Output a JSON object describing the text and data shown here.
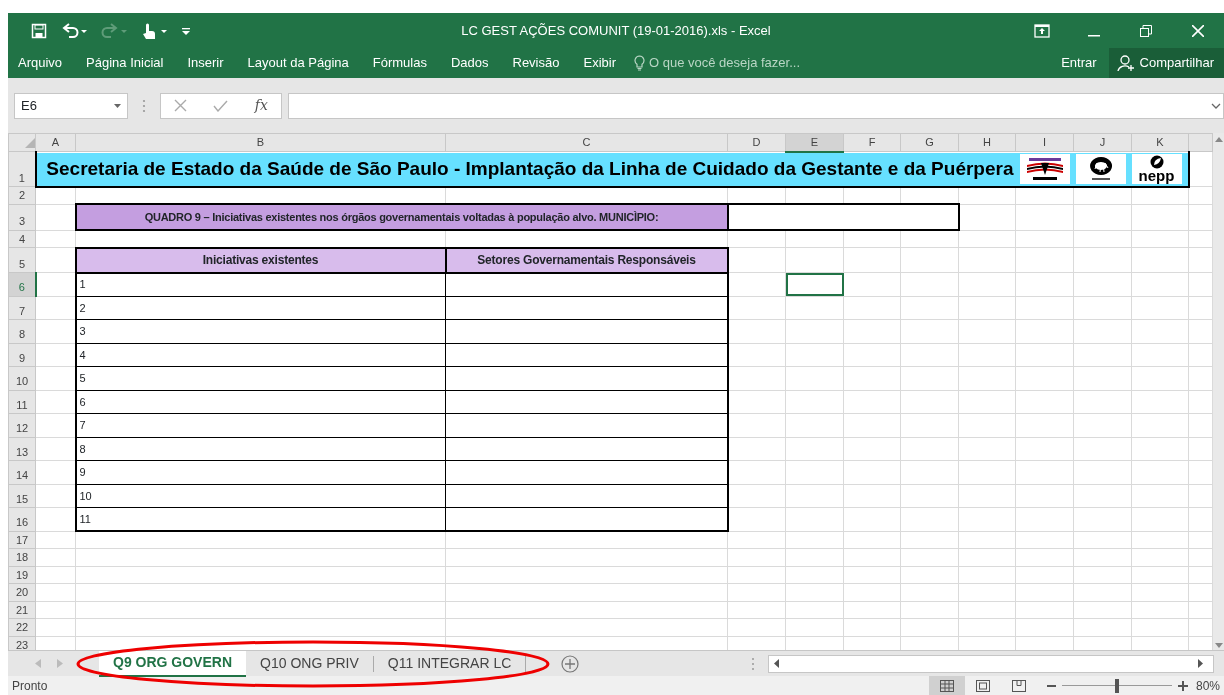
{
  "window": {
    "title": "LC GEST AÇÕES COMUNIT (19-01-2016).xls - Excel"
  },
  "quick_access": [
    {
      "kind": "save",
      "disabled": false
    },
    {
      "kind": "undo",
      "disabled": false
    },
    {
      "kind": "redo",
      "disabled": true
    },
    {
      "kind": "touch",
      "disabled": false
    },
    {
      "kind": "customize",
      "disabled": false
    }
  ],
  "ribbon_tabs": [
    {
      "label": "Arquivo",
      "selected": false
    },
    {
      "label": "Página Inicial",
      "selected": false
    },
    {
      "label": "Inserir",
      "selected": false
    },
    {
      "label": "Layout da Página",
      "selected": false
    },
    {
      "label": "Fórmulas",
      "selected": false
    },
    {
      "label": "Dados",
      "selected": false
    },
    {
      "label": "Revisão",
      "selected": false
    },
    {
      "label": "Exibir",
      "selected": false
    }
  ],
  "tell_me": {
    "placeholder": "O que você deseja fazer..."
  },
  "account": {
    "sign_in": "Entrar",
    "share": "Compartilhar"
  },
  "formula_bar": {
    "name_box": "E6",
    "function_label": "fx"
  },
  "sheet": {
    "columns": [
      {
        "label": "A",
        "selected": false
      },
      {
        "label": "B",
        "selected": false
      },
      {
        "label": "C",
        "selected": false
      },
      {
        "label": "D",
        "selected": false
      },
      {
        "label": "E",
        "selected": true
      },
      {
        "label": "F",
        "selected": false
      },
      {
        "label": "G",
        "selected": false
      },
      {
        "label": "H",
        "selected": false
      },
      {
        "label": "I",
        "selected": false
      },
      {
        "label": "J",
        "selected": false
      },
      {
        "label": "K",
        "selected": false
      }
    ],
    "rows": [
      {
        "label": "1",
        "selected": false
      },
      {
        "label": "2",
        "selected": false
      },
      {
        "label": "3",
        "selected": false
      },
      {
        "label": "4",
        "selected": false
      },
      {
        "label": "5",
        "selected": false
      },
      {
        "label": "6",
        "selected": true
      },
      {
        "label": "7",
        "selected": false
      },
      {
        "label": "8",
        "selected": false
      },
      {
        "label": "9",
        "selected": false
      },
      {
        "label": "10",
        "selected": false
      },
      {
        "label": "11",
        "selected": false
      },
      {
        "label": "12",
        "selected": false
      },
      {
        "label": "13",
        "selected": false
      },
      {
        "label": "14",
        "selected": false
      },
      {
        "label": "15",
        "selected": false
      },
      {
        "label": "16",
        "selected": false
      },
      {
        "label": "17",
        "selected": false
      },
      {
        "label": "18",
        "selected": false
      },
      {
        "label": "19",
        "selected": false
      },
      {
        "label": "20",
        "selected": false
      },
      {
        "label": "21",
        "selected": false
      },
      {
        "label": "22",
        "selected": false
      },
      {
        "label": "23",
        "selected": false
      }
    ],
    "title": "Secretaria de Estado da Saúde de São Paulo - Implantação da Linha de Cuidado da Gestante e da Puérpera",
    "logos": [
      {
        "kind": "sp"
      },
      {
        "kind": "unicamp"
      },
      {
        "kind": "nepp",
        "bottom": "nepp"
      }
    ],
    "caption": "QUADRO 9 – Iniciativas existentes nos órgãos governamentais voltadas à população alvo. MUNICÌPIO:",
    "headers": [
      "Iniciativas existentes",
      "Setores Governamentais Responsáveis"
    ],
    "items": [
      "1",
      "2",
      "3",
      "4",
      "5",
      "6",
      "7",
      "8",
      "9",
      "10",
      "11"
    ]
  },
  "sheet_tabs": [
    {
      "label": "Q9 ORG GOVERN",
      "selected": true
    },
    {
      "label": "Q10 ONG PRIV",
      "selected": false
    },
    {
      "label": "Q11 INTEGRAR LC",
      "selected": false
    }
  ],
  "status_bar": {
    "text": "Pronto",
    "views": [
      {
        "kind": "normal",
        "selected": true
      },
      {
        "kind": "page_layout",
        "selected": false
      },
      {
        "kind": "page_break",
        "selected": false
      }
    ],
    "zoom": {
      "level": 0.5,
      "reading": "80%"
    }
  }
}
